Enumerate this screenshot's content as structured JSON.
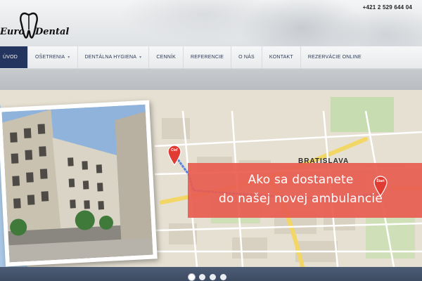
{
  "header": {
    "logo_left": "Euro",
    "logo_right": "Dental",
    "phone": "+421 2 529 644 04"
  },
  "nav": {
    "items": [
      {
        "label": "ÚVOD",
        "active": true,
        "has_dropdown": false
      },
      {
        "label": "OŠETRENIA",
        "active": false,
        "has_dropdown": true
      },
      {
        "label": "DENTÁLNA HYGIENA",
        "active": false,
        "has_dropdown": true
      },
      {
        "label": "CENNÍK",
        "active": false,
        "has_dropdown": false
      },
      {
        "label": "REFERENCIE",
        "active": false,
        "has_dropdown": false
      },
      {
        "label": "O NÁS",
        "active": false,
        "has_dropdown": false
      },
      {
        "label": "KONTAKT",
        "active": false,
        "has_dropdown": false
      },
      {
        "label": "REZERVÁCIE ONLINE",
        "active": false,
        "has_dropdown": false
      }
    ]
  },
  "slide": {
    "banner_line1": "Ako sa dostanete",
    "banner_line2": "do našej novej ambulancie",
    "city": "BRATISLAVA",
    "marker_start": "Štart",
    "marker_end": "Cieľ",
    "slide_count": 4,
    "active_slide": 1
  },
  "colors": {
    "nav_active_bg": "#23345e",
    "banner_bg": "#e85c50",
    "route": "#4a78e0",
    "marker": "#e03c34"
  }
}
